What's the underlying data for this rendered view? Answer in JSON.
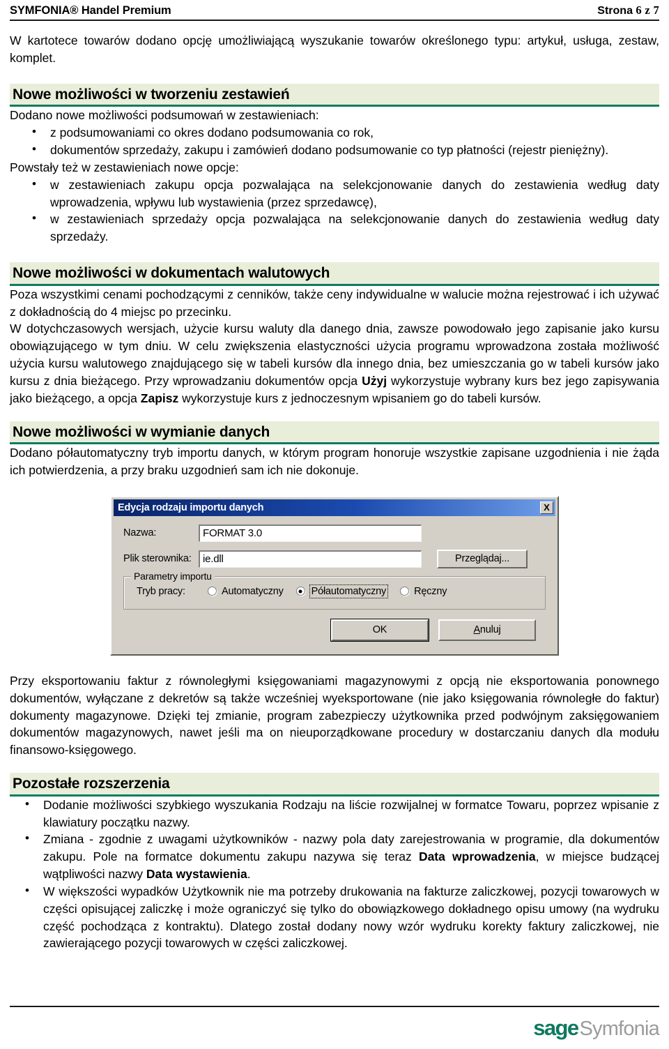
{
  "header": {
    "product": "SYMFONIA® Handel Premium",
    "page_label": "Strona",
    "page_numbers": "6 z 7"
  },
  "intro": {
    "paragraph": "W kartotece towarów dodano opcję umożliwiającą wyszukanie towarów określonego typu: artykuł, usługa, zestaw, komplet."
  },
  "sections": [
    {
      "heading": "Nowe możliwości w tworzeniu zestawień",
      "lead": "Dodano nowe możliwości podsumowań w zestawieniach:",
      "bullets": [
        "z podsumowaniami co okres dodano podsumowania co rok,",
        "dokumentów sprzedaży, zakupu i zamówień dodano podsumowanie co typ płatności (rejestr pieniężny)."
      ],
      "lead2": "Powstały też w zestawieniach nowe opcje:",
      "bullets2": [
        "w zestawieniach zakupu opcja pozwalająca na selekcjonowanie danych do zestawienia według daty wprowadzenia, wpływu lub wystawienia (przez sprzedawcę),",
        "w zestawieniach sprzedaży opcja pozwalająca na selekcjonowanie danych do zestawienia według daty sprzedaży."
      ]
    },
    {
      "heading": "Nowe możliwości w dokumentach walutowych",
      "p1": "Poza wszystkimi cenami pochodzącymi z cenników, także ceny indywidualne w walucie można rejestrować i ich używać z dokładnością do 4 miejsc po przecinku.",
      "p2_a": "W dotychczasowych wersjach, użycie kursu waluty dla danego dnia, zawsze powodowało jego zapisanie jako kursu obowiązującego w tym dniu. W celu zwiększenia elastyczności użycia programu wprowadzona została możliwość użycia kursu walutowego znajdującego się w tabeli kursów dla innego dnia, bez umieszczania go w tabeli kursów jako kursu z dnia bieżącego. Przy wprowadzaniu dokumentów opcja ",
      "p2_b1": "Użyj",
      "p2_c": " wykorzystuje wybrany kurs bez jego zapisywania jako bieżącego, a opcja ",
      "p2_b2": "Zapisz",
      "p2_d": " wykorzystuje kurs z jednoczesnym wpisaniem go do tabeli kursów."
    },
    {
      "heading": "Nowe możliwości w wymianie danych",
      "p1": "Dodano półautomatyczny tryb importu danych, w którym program honoruje wszystkie zapisane uzgodnienia i nie żąda ich potwierdzenia, a przy braku uzgodnień sam ich nie dokonuje."
    }
  ],
  "dialog": {
    "title": "Edycja rodzaju importu danych",
    "close_icon": "✕",
    "close_glyph": "X",
    "fields": [
      {
        "label": "Nazwa:",
        "value": "FORMAT 3.0"
      },
      {
        "label": "Plik sterownika:",
        "value": "ie.dll"
      }
    ],
    "browse_button": "Przeglądaj...",
    "group_legend": "Parametry importu",
    "mode_label": "Tryb pracy:",
    "radios": [
      {
        "label": "Automatyczny",
        "checked": false,
        "focused": false
      },
      {
        "label": "Półautomatyczny",
        "checked": true,
        "focused": true
      },
      {
        "label": "Ręczny",
        "checked": false,
        "focused": false
      }
    ],
    "ok_button": "OK",
    "cancel_button": "Anuluj",
    "cancel_accel": "A",
    "cancel_rest": "nuluj"
  },
  "after_dialog": {
    "paragraph": "Przy eksportowaniu faktur z równoległymi księgowaniami magazynowymi z opcją nie eksportowania ponownego dokumentów, wyłączane z dekretów są także wcześniej wyeksportowane (nie jako księgowania równoległe do faktur) dokumenty magazynowe. Dzięki tej zmianie, program zabezpieczy użytkownika przed podwójnym zaksięgowaniem dokumentów magazynowych, nawet jeśli ma on nieuporządkowane procedury w dostarczaniu danych dla modułu finansowo-księgowego."
  },
  "last_section": {
    "heading": "Pozostałe rozszerzenia",
    "b1": "Dodanie możliwości szybkiego wyszukania Rodzaju na liście rozwijalnej w formatce Towaru, poprzez wpisanie z klawiatury początku nazwy.",
    "b2_a": "Zmiana - zgodnie z uwagami użytkowników - nazwy pola daty zarejestrowania w programie, dla dokumentów zakupu. Pole na formatce dokumentu zakupu nazywa się teraz ",
    "b2_bold1": "Data wprowadzenia",
    "b2_b": ", w miejsce budzącej wątpliwości nazwy ",
    "b2_bold2": "Data wystawienia",
    "b2_c": ".",
    "b3": "W większości wypadków Użytkownik nie ma potrzeby drukowania na fakturze zaliczkowej, pozycji towarowych w części opisującej zaliczkę i może ograniczyć się tylko do obowiązkowego dokładnego opisu umowy (na wydruku część pochodząca z kontraktu). Dlatego został dodany nowy wzór wydruku korekty faktury zaliczkowej, nie zawierającego pozycji towarowych w części zaliczkowej."
  },
  "footer": {
    "logo_sage": "sage",
    "logo_symfonia": "Symfonia",
    "accent_green": "#0d7a5f",
    "accent_gray": "#9b9b9b"
  }
}
